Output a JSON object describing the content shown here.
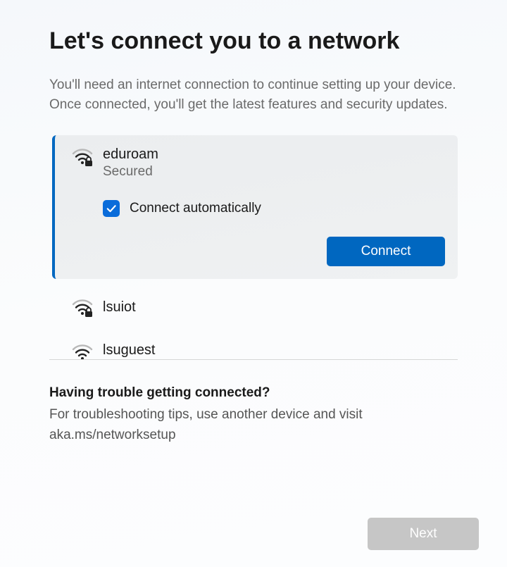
{
  "header": {
    "title": "Let's connect you to a network",
    "subtitle": "You'll need an internet connection to continue setting up your device. Once connected, you'll get the latest features and security updates."
  },
  "networks": {
    "selected": {
      "name": "eduroam",
      "security": "Secured",
      "auto_connect_label": "Connect automatically",
      "auto_connect_checked": true,
      "connect_label": "Connect"
    },
    "others": [
      {
        "name": "lsuiot"
      },
      {
        "name": "lsuguest"
      }
    ]
  },
  "trouble": {
    "title": "Having trouble getting connected?",
    "text": "For troubleshooting tips, use another device and visit aka.ms/networksetup"
  },
  "footer": {
    "next_label": "Next"
  },
  "icons": {
    "wifi_secured": "wifi-secured-icon",
    "check": "check-icon"
  },
  "colors": {
    "accent": "#0067c0",
    "checkbox": "#0a6cda",
    "disabled": "#c6c6c6"
  }
}
